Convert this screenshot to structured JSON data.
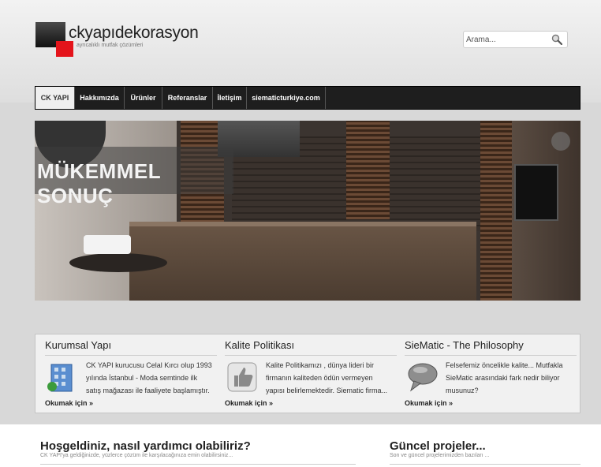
{
  "logo": {
    "name": "ckyapıdekorasyon",
    "tagline": "ayrıcalıklı mutfak çözümleri"
  },
  "search": {
    "placeholder": "Arama..."
  },
  "nav": {
    "items": [
      "CK YAPI",
      "Hakkımızda",
      "Ürünler",
      "Referanslar",
      "İletişim",
      "siematicturkiye.com"
    ],
    "active": "CK YAPI"
  },
  "banner": {
    "caption": "MÜKEMMEL SONUÇ"
  },
  "boxes": [
    {
      "title": "Kurumsal Yapı",
      "text": "CK YAPI kurucusu Celal Kırcı olup 1993 yılında İstanbul - Moda semtinde ilk satış mağazası ile faaliyete başlamıştır.",
      "more": "Okumak için »",
      "icon": "building-icon"
    },
    {
      "title": "Kalite Politikası",
      "text": "Kalite Politikamızı , dünya lideri bir firmanın kaliteden ödün vermeyen yapısı belirlemektedir. Siematic firma...",
      "more": "Okumak için »",
      "icon": "thumbs-up-icon"
    },
    {
      "title": "SieMatic - The Philosophy",
      "text": "Felsefemiz öncelikle kalite... Mutfakla SieMatic arasındaki fark nedir biliyor musunuz?",
      "more": "Okumak için »",
      "icon": "speech-bubble-icon"
    }
  ],
  "welcome": {
    "title": "Hoşgeldiniz, nasıl yardımcı olabiliriz?",
    "subtitle": "CK YAPI'ya geldiğinizde, yüzlerce çözüm ile karşılacağınıza emin olabilirsiniz..."
  },
  "projects": {
    "title": "Güncel projeler...",
    "subtitle": "Son ve güncel projelerimizden bazıları ..."
  },
  "colors": {
    "nav_bg": "#1e1e1e",
    "accent_red": "#e4141b",
    "page_bg": "#d8d8d8"
  }
}
